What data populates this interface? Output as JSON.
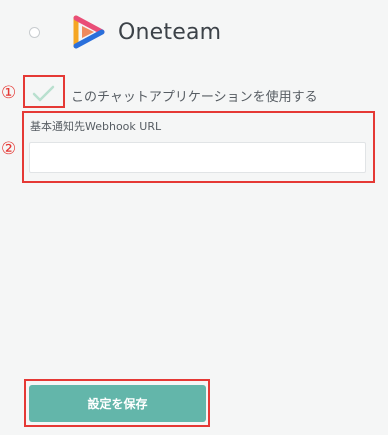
{
  "app": {
    "name": "Oneteam"
  },
  "settings": {
    "enable_label": "このチャットアプリケーションを使用する",
    "enable_checked": true,
    "webhook_label": "基本通知先Webhook URL",
    "webhook_value": ""
  },
  "annotations": {
    "badge_1": "①",
    "badge_2": "②"
  },
  "actions": {
    "save_label": "設定を保存"
  },
  "colors": {
    "accent": "#63b6aa",
    "annotation": "#e53935"
  }
}
